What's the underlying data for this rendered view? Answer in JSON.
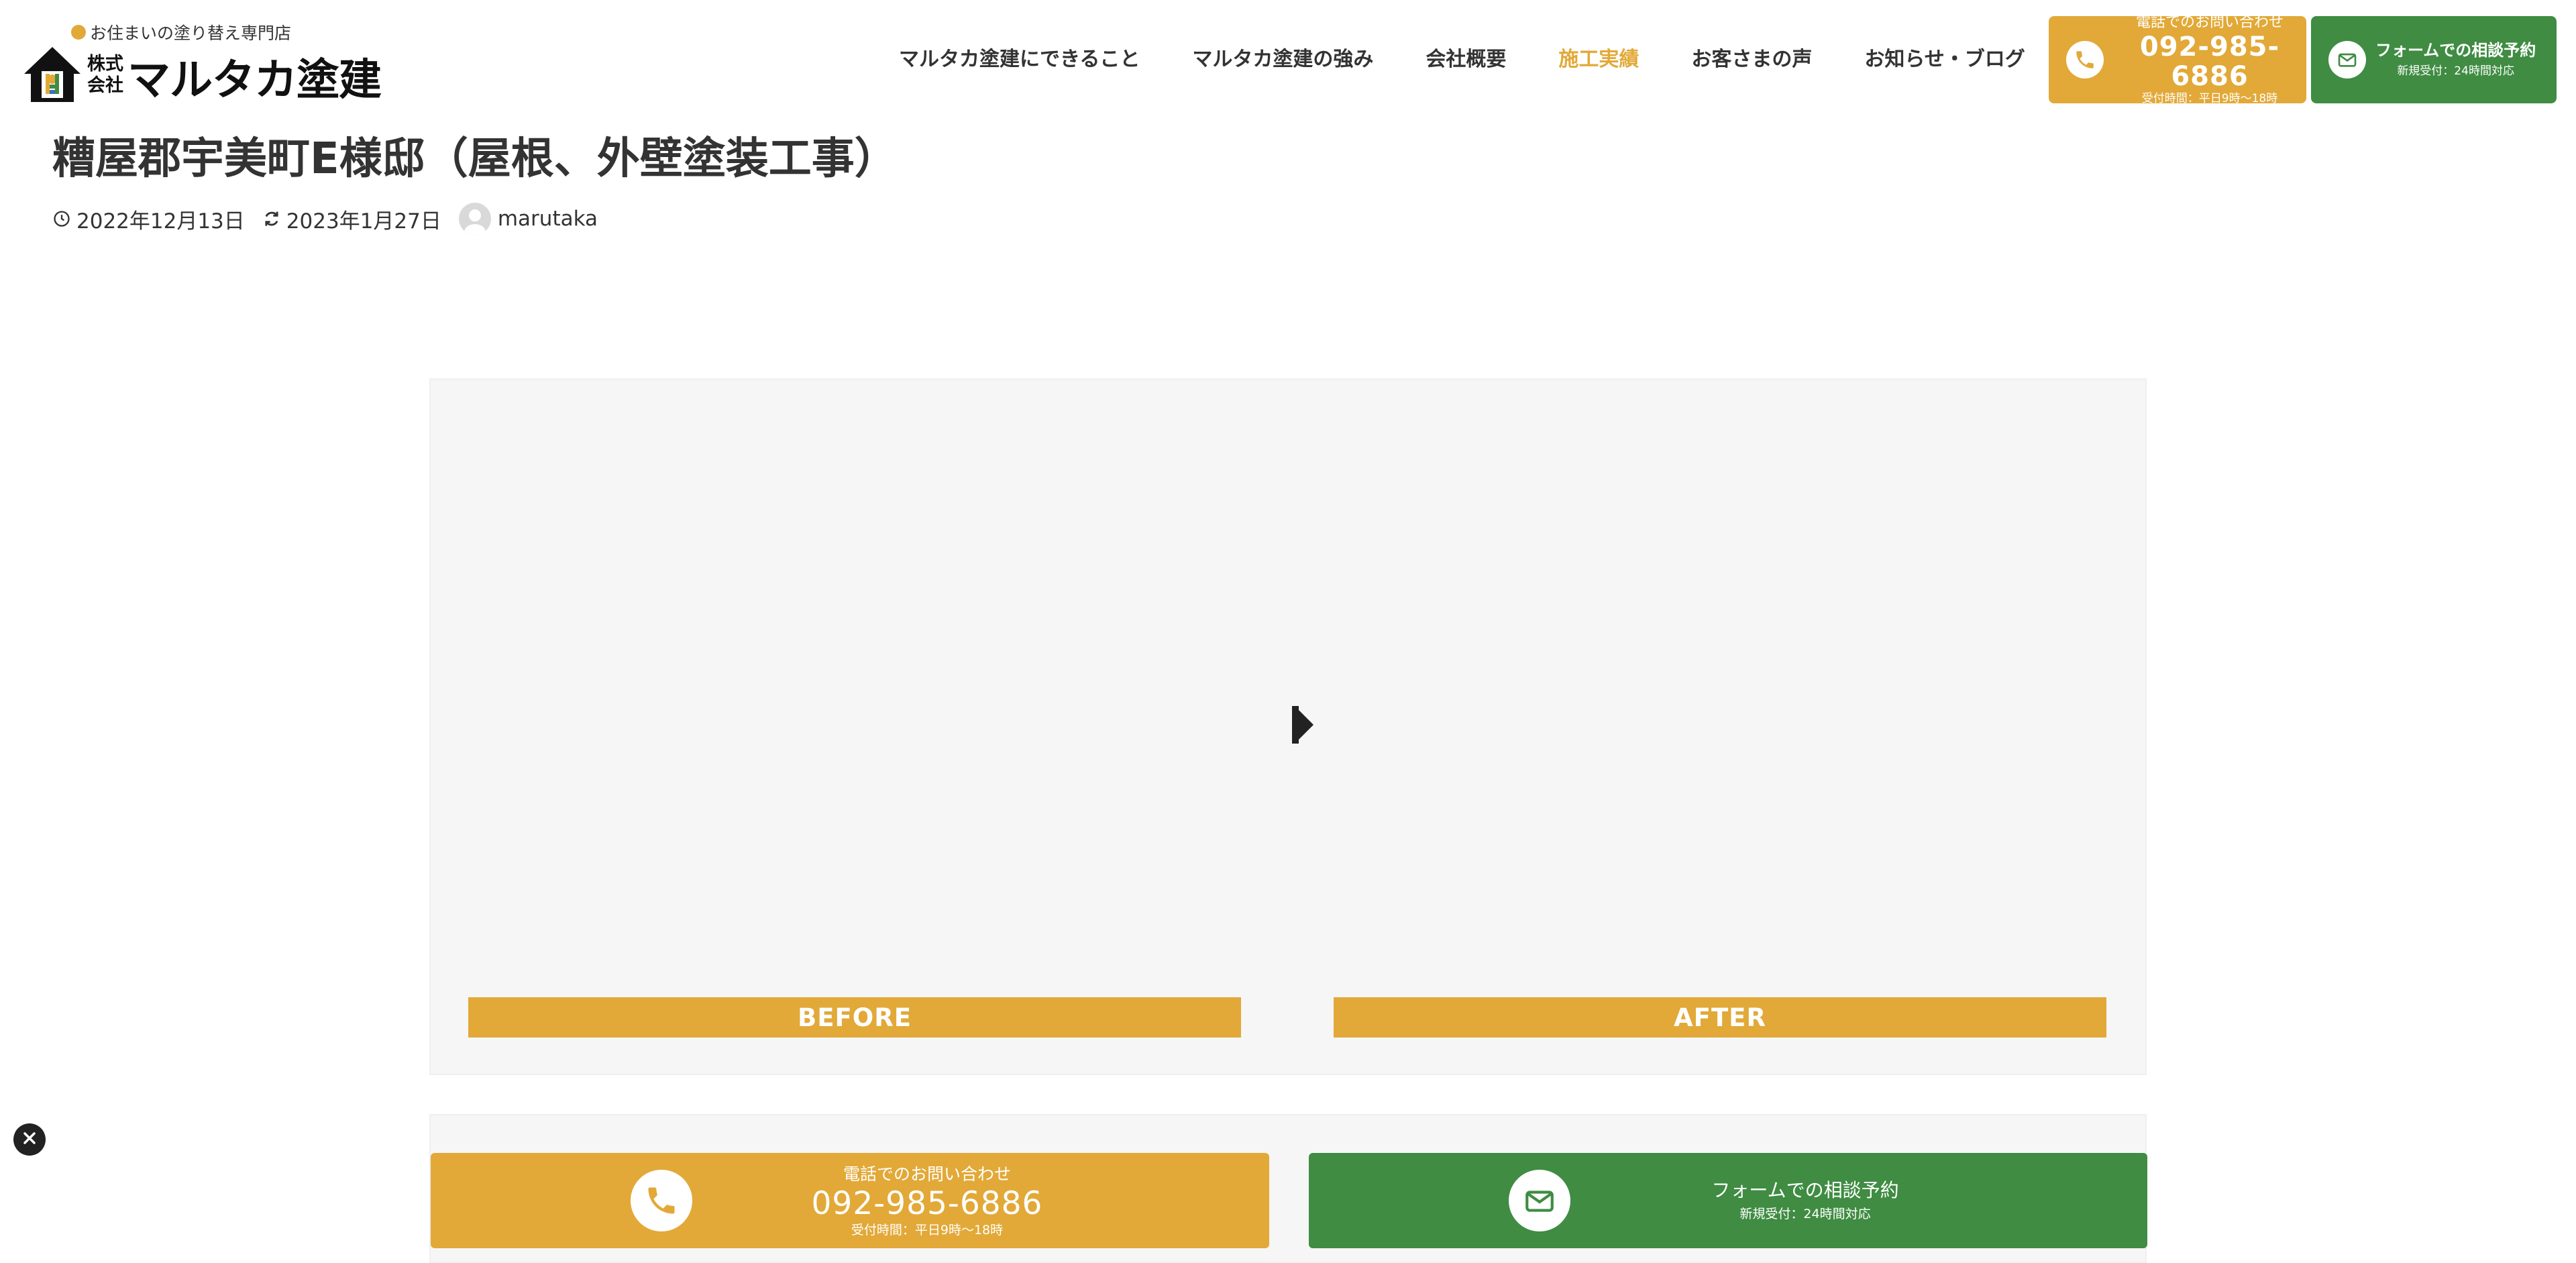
{
  "brand": {
    "tagline": "お住まいの塗り替え専門店",
    "company_type": "株式会社",
    "name": "マルタカ塗建"
  },
  "nav": {
    "items": [
      {
        "label": "マルタカ塗建にできること",
        "active": false
      },
      {
        "label": "マルタカ塗建の強み",
        "active": false
      },
      {
        "label": "会社概要",
        "active": false
      },
      {
        "label": "施工実績",
        "active": true
      },
      {
        "label": "お客さまの声",
        "active": false
      },
      {
        "label": "お知らせ・ブログ",
        "active": false
      }
    ]
  },
  "contact": {
    "phone_label": "電話でのお問い合わせ",
    "phone_number": "092-985-6886",
    "phone_hours": "受付時間：平日9時〜18時",
    "form_label": "フォームでの相談予約",
    "form_hours": "新規受付：24時間対応"
  },
  "post": {
    "title": "糟屋郡宇美町E様邸（屋根、外壁塗装工事）",
    "published": "2022年12月13日",
    "updated": "2023年1月27日",
    "author": "marutaka"
  },
  "comparison": {
    "before_label": "BEFORE",
    "after_label": "AFTER"
  },
  "colors": {
    "accent_yellow": "#e2a938",
    "accent_green": "#3f8c42",
    "text": "#333333",
    "panel_bg": "#f6f6f6"
  },
  "icons": [
    "phone-icon",
    "mail-icon",
    "clock-icon",
    "refresh-icon",
    "avatar",
    "play-arrow-icon",
    "close-icon",
    "house-logo-icon"
  ]
}
